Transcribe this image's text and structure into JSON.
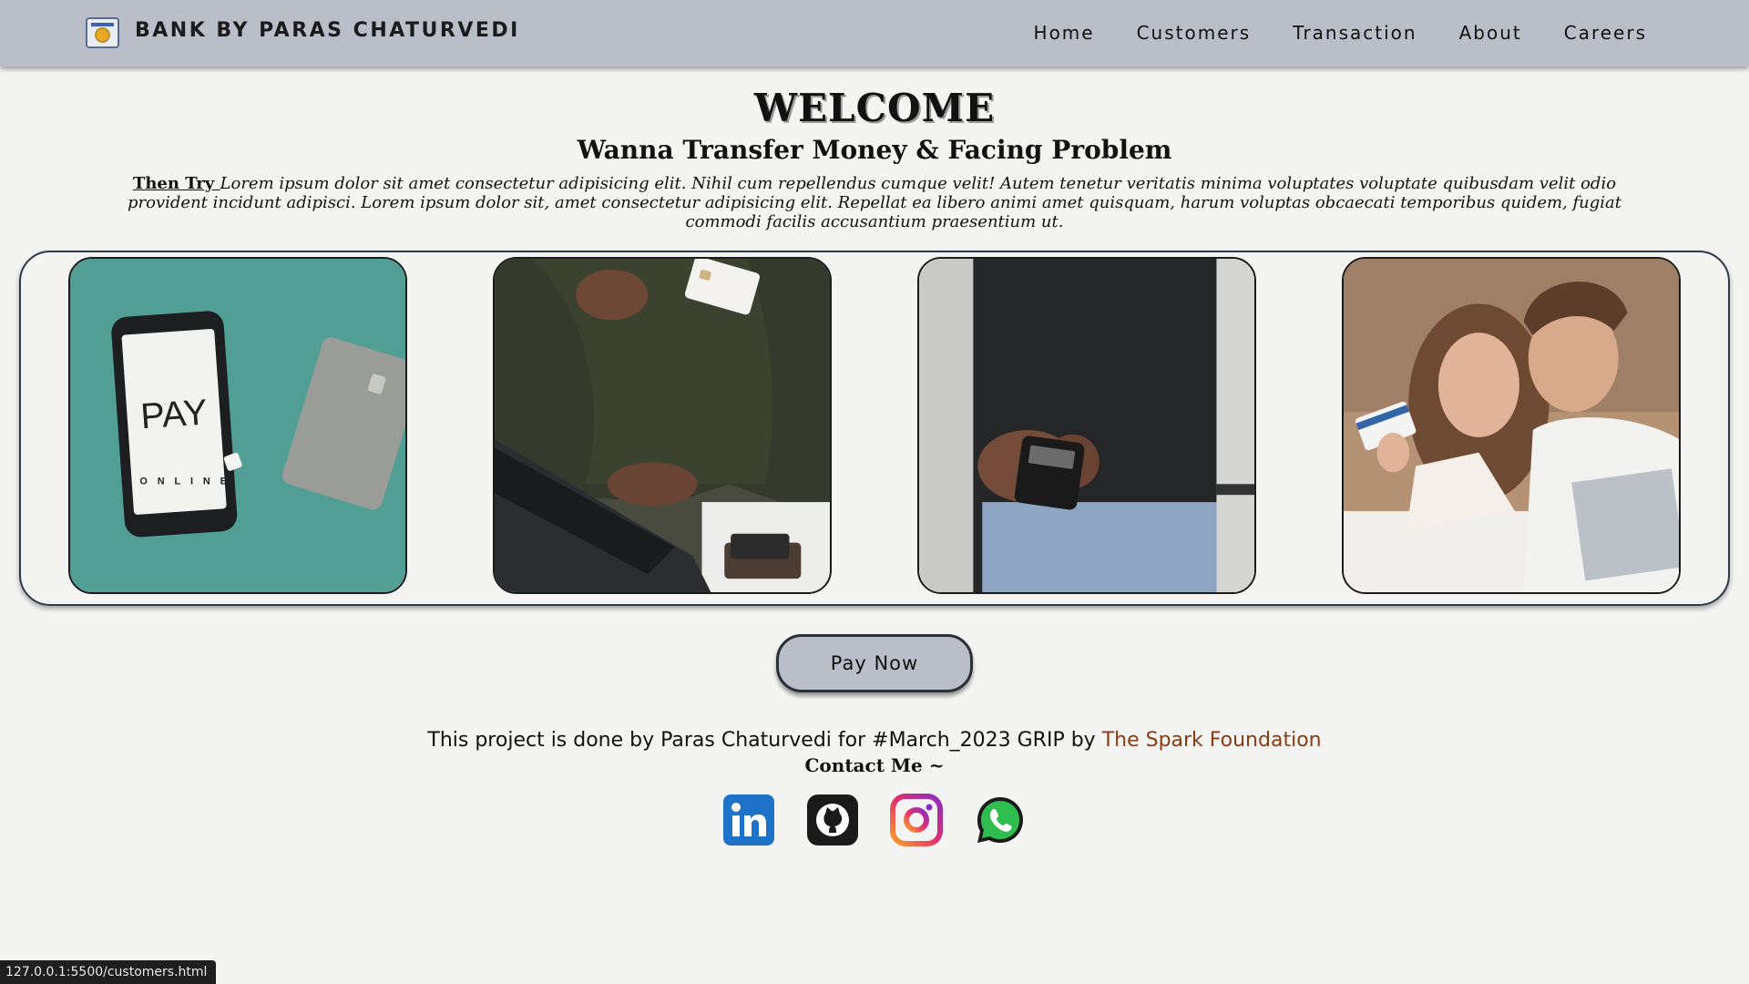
{
  "nav": {
    "brand": "BANK BY PARAS CHATURVEDI",
    "links": [
      {
        "label": "Home"
      },
      {
        "label": "Customers"
      },
      {
        "label": "Transaction"
      },
      {
        "label": "About"
      },
      {
        "label": "Careers"
      }
    ]
  },
  "hero": {
    "title": "WELCOME",
    "subtitle": "Wanna Transfer Money & Facing Problem",
    "lead": "Then Try ",
    "body": "Lorem ipsum dolor sit amet consectetur adipisicing elit. Nihil cum repellendus cumque velit! Autem tenetur veritatis minima voluptates voluptate quibusdam velit odio provident incidunt adipisci. Lorem ipsum dolor sit, amet consectetur adipisicing elit. Repellat ea libero animi amet quisquam, harum voluptas obcaecati temporibus quidem, fugiat commodi facilis accusantium praesentium ut."
  },
  "photos": {
    "pay_text": "PAY",
    "online_text": "ONLINE"
  },
  "pay_button": "Pay Now",
  "footer": {
    "credit_prefix": "This project is done by Paras Chaturvedi for #March_2023 GRIP by ",
    "credit_org": "The Spark Foundation",
    "contact": "Contact Me ~"
  },
  "status_url": "127.0.0.1:5500/customers.html",
  "colors": {
    "navbar": "#b9bec9",
    "background": "#f4f4f2",
    "accent_link": "#8a3b12",
    "button": "#b9bec9"
  }
}
